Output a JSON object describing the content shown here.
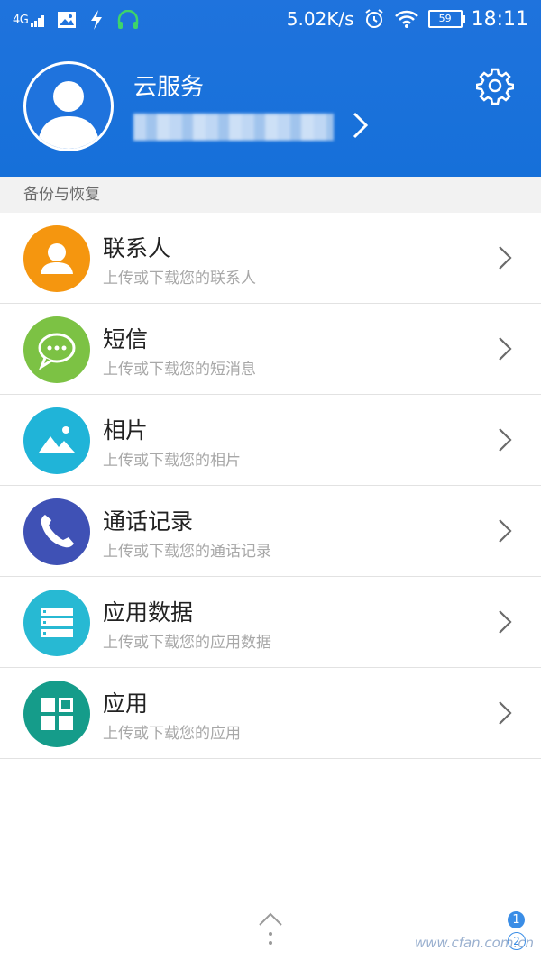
{
  "status_bar": {
    "network": "4G",
    "speed": "5.02K/s",
    "battery": "59",
    "time": "18:11"
  },
  "account": {
    "name": "云服务"
  },
  "section": {
    "title": "备份与恢复"
  },
  "items": [
    {
      "title": "联系人",
      "desc": "上传或下载您的联系人",
      "color": "#f5960f",
      "icon": "contact-icon"
    },
    {
      "title": "短信",
      "desc": "上传或下载您的短消息",
      "color": "#7cc244",
      "icon": "message-icon"
    },
    {
      "title": "相片",
      "desc": "上传或下载您的相片",
      "color": "#20b4d8",
      "icon": "photo-icon"
    },
    {
      "title": "通话记录",
      "desc": "上传或下载您的通话记录",
      "color": "#3f51b5",
      "icon": "phone-icon"
    },
    {
      "title": "应用数据",
      "desc": "上传或下载您的应用数据",
      "color": "#27b9d3",
      "icon": "app-data-icon"
    },
    {
      "title": "应用",
      "desc": "上传或下载您的应用",
      "color": "#159c8a",
      "icon": "apps-icon"
    }
  ],
  "watermark": "www.cfan.com.cn",
  "badges": [
    "1",
    "2"
  ]
}
